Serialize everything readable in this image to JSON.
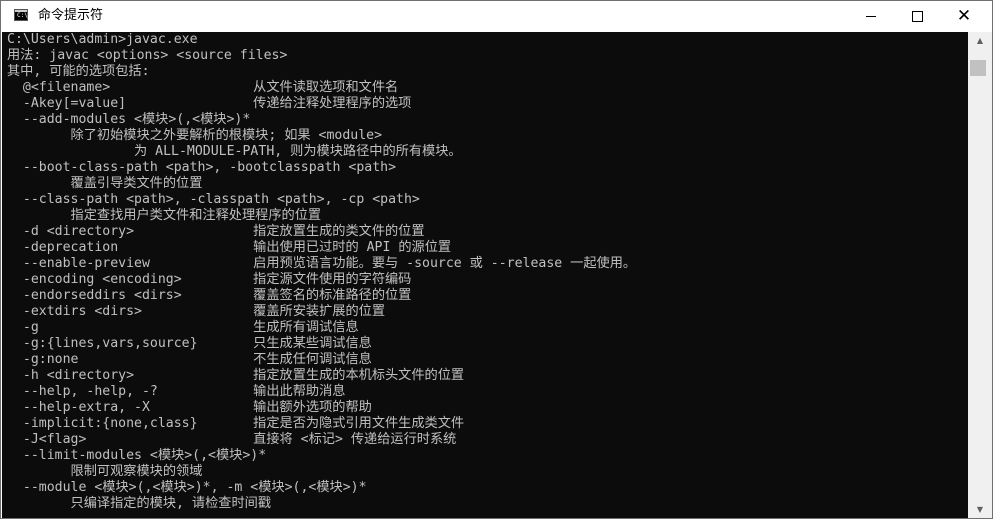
{
  "window": {
    "title": "命令提示符",
    "icon_label": "C:\\",
    "min_glyph": "minimize",
    "max_glyph": "maximize",
    "close_glyph": "✕"
  },
  "console": {
    "lines": [
      "C:\\Users\\admin>javac.exe",
      "用法: javac <options> <source files>",
      "其中, 可能的选项包括:",
      "  @<filename>                  从文件读取选项和文件名",
      "  -Akey[=value]                传递给注释处理程序的选项",
      "  --add-modules <模块>(,<模块>)*",
      "        除了初始模块之外要解析的根模块; 如果 <module>",
      "                为 ALL-MODULE-PATH, 则为模块路径中的所有模块。",
      "  --boot-class-path <path>, -bootclasspath <path>",
      "        覆盖引导类文件的位置",
      "  --class-path <path>, -classpath <path>, -cp <path>",
      "        指定查找用户类文件和注释处理程序的位置",
      "  -d <directory>               指定放置生成的类文件的位置",
      "  -deprecation                 输出使用已过时的 API 的源位置",
      "  --enable-preview             启用预览语言功能。要与 -source 或 --release 一起使用。",
      "  -encoding <encoding>         指定源文件使用的字符编码",
      "  -endorseddirs <dirs>         覆盖签名的标准路径的位置",
      "  -extdirs <dirs>              覆盖所安装扩展的位置",
      "  -g                           生成所有调试信息",
      "  -g:{lines,vars,source}       只生成某些调试信息",
      "  -g:none                      不生成任何调试信息",
      "  -h <directory>               指定放置生成的本机标头文件的位置",
      "  --help, -help, -?            输出此帮助消息",
      "  --help-extra, -X             输出额外选项的帮助",
      "  -implicit:{none,class}       指定是否为隐式引用文件生成类文件",
      "  -J<flag>                     直接将 <标记> 传递给运行时系统",
      "  --limit-modules <模块>(,<模块>)*",
      "        限制可观察模块的领域",
      "  --module <模块>(,<模块>)*, -m <模块>(,<模块>)*",
      "        只编译指定的模块, 请检查时间戳"
    ]
  },
  "scrollbar": {
    "up_arrow": "▲",
    "down_arrow": "▼"
  },
  "colors": {
    "console_bg": "#0c0c0c",
    "console_fg": "#c0c0c0",
    "titlebar_bg": "#ffffff"
  }
}
